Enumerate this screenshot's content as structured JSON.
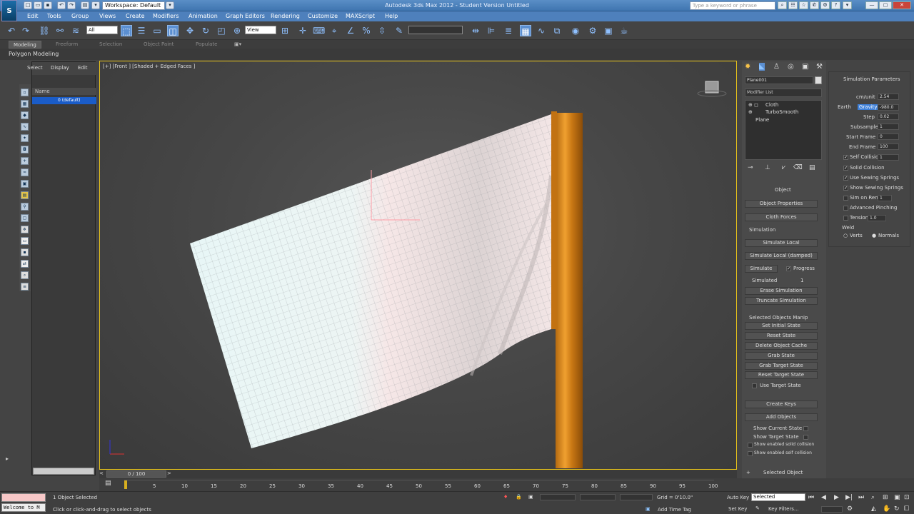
{
  "title_bar": {
    "workspace": "Workspace: Default",
    "window_title": "Autodesk 3ds Max 2012 - Student Version   Untitled",
    "search_placeholder": "Type a keyword or phrase"
  },
  "menus": [
    "Edit",
    "Tools",
    "Group",
    "Views",
    "Create",
    "Modifiers",
    "Animation",
    "Graph Editors",
    "Rendering",
    "Customize",
    "MAXScript",
    "Help"
  ],
  "toolbar": {
    "selection_filter": "All",
    "ref_coord": "View"
  },
  "ribbon": {
    "tabs": [
      "Modeling",
      "Freeform",
      "Selection",
      "Object Paint",
      "Populate"
    ],
    "active_tab": "Modeling",
    "title": "Polygon Modeling"
  },
  "scene_explorer": {
    "tabs": [
      "Select",
      "Display",
      "Edit"
    ],
    "column_header": "Name",
    "layer": "0 (default)"
  },
  "viewport": {
    "label": "[+] [Front ] [Shaded + Edged Faces ]"
  },
  "command_panel": {
    "object_name": "Plane001",
    "modifier_list": "Modifier List",
    "stack": [
      "Cloth",
      "TurboSmooth",
      "Plane"
    ],
    "object_section": "Object",
    "buttons_top": [
      "Object Properties",
      "Cloth Forces"
    ],
    "simulation_label": "Simulation",
    "simulation_buttons": [
      "Simulate Local",
      "Simulate Local (damped)"
    ],
    "simulate": "Simulate",
    "progress": "Progress",
    "simulated_label": "Simulated",
    "simulated_value": "1",
    "erase": "Erase Simulation",
    "truncate": "Truncate Simulation",
    "selected_objects_manip": "Selected Objects Manip",
    "manip_buttons": [
      "Set Initial State",
      "Reset State",
      "Delete Object Cache",
      "Grab State",
      "Grab Target State",
      "Reset Target State"
    ],
    "use_target_state": "Use Target State",
    "create_keys": "Create Keys",
    "add_objects": "Add Objects",
    "show_options": [
      "Show Current State",
      "Show Target State",
      "Show enabled solid collision",
      "Show enabled self collision"
    ],
    "selected_object": "Selected Object"
  },
  "sim_params": {
    "title": "Simulation Parameters",
    "cm_unit_label": "cm/unit",
    "cm_unit_value": "2.54",
    "earth": "Earth",
    "gravity": "Gravity",
    "gravity_value": "-980.0",
    "step_label": "Step",
    "step_value": "0.02",
    "subsample_label": "Subsample",
    "subsample_value": "1",
    "start_frame_label": "Start Frame",
    "start_frame_value": "0",
    "end_frame_label": "End Frame",
    "end_frame_value": "100",
    "self_collision": "Self Collision",
    "self_collision_value": "1",
    "solid_collision": "Solid Collision",
    "use_sewing": "Use Sewing Springs",
    "show_sewing": "Show Sewing Springs",
    "sim_on_render": "Sim on Render",
    "sim_on_render_value": "1",
    "adv_pinching": "Advanced Pinching",
    "tension": "Tension",
    "tension_value": "1.0",
    "weld": "Weld",
    "verts": "Verts",
    "normals": "Normals"
  },
  "timeline": {
    "frame": "0 / 100",
    "ticks": [
      "0",
      "5",
      "10",
      "15",
      "20",
      "25",
      "30",
      "35",
      "40",
      "45",
      "50",
      "55",
      "60",
      "65",
      "70",
      "75",
      "80",
      "85",
      "90",
      "95",
      "100"
    ]
  },
  "status_bar": {
    "maxscript": "Welcome to M",
    "selected": "1 Object Selected",
    "prompt": "Click or click-and-drag to select objects",
    "grid": "Grid = 0'10.0\"",
    "auto_key": "Auto Key",
    "selected_dropdown": "Selected",
    "set_key": "Set Key",
    "key_filters": "Key Filters...",
    "add_time_tag": "Add Time Tag"
  }
}
